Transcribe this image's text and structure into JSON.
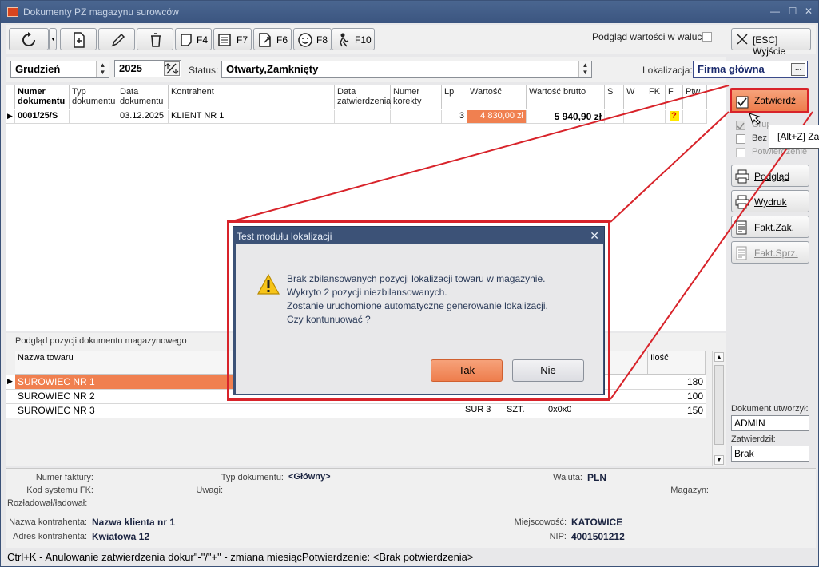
{
  "window": {
    "title": "Dokumenty PZ magazynu surowców"
  },
  "toolbar": {
    "f4": "F4",
    "f7": "F7",
    "f6": "F6",
    "f8": "F8",
    "f10": "F10",
    "currency_preview": "Podgląd wartości w walucie",
    "exit": "[ESC] Wyjście"
  },
  "filters": {
    "month": "Grudzień",
    "year": "2025",
    "status_label": "Status:",
    "status_value": "Otwarty,Zamknięty",
    "location_label": "Lokalizacja:",
    "location_value": "Firma główna",
    "browse": "..."
  },
  "grid": {
    "headers": {
      "number": "Numer dokumentu",
      "type": "Typ dokumentu",
      "date": "Data dokumentu",
      "contractor": "Kontrahent",
      "approval_date": "Data zatwierdzenia",
      "correction": "Numer korekty",
      "lp": "Lp",
      "value": "Wartość",
      "gross": "Wartość brutto",
      "s": "S",
      "w": "W",
      "fk": "FK",
      "f": "F",
      "ptw": "Ptw"
    },
    "rows": [
      {
        "number": "0001/25/S",
        "type": "",
        "date": "03.12.2025",
        "contractor": "KLIENT NR 1",
        "approval_date": "",
        "correction": "",
        "lp": "3",
        "value": "4 830,00 zł",
        "gross": "5 940,90 zł",
        "f": "?"
      }
    ]
  },
  "side": {
    "approve": "Zatwierdź",
    "group": "Grupowo",
    "bez": "Bez",
    "confirm": "Potwierdzenie",
    "preview": "Podgląd",
    "print": "Wydruk",
    "fakt_zak": "Fakt.Zak.",
    "fakt_sprz": "Fakt.Sprz.",
    "created_by_label": "Dokument utworzył:",
    "created_by": "ADMIN",
    "approved_by_label": "Zatwierdził:",
    "approved_by": "Brak",
    "tooltip": "[Alt+Z] Zatwierdź"
  },
  "items": {
    "section_title": "Podgląd pozycji dokumentu magazynowego",
    "headers": {
      "name": "Nazwa towaru",
      "qty": "Ilość"
    },
    "rows": [
      {
        "name": "SUROWIEC NR 1",
        "code": "",
        "unit": "",
        "loc": "",
        "qty": "180"
      },
      {
        "name": "SUROWIEC NR 2",
        "code": "",
        "unit": "",
        "loc": "",
        "qty": "100"
      },
      {
        "name": "SUROWIEC NR 3",
        "code": "SUR 3",
        "unit": "SZT.",
        "loc": "0x0x0",
        "qty": "150"
      }
    ]
  },
  "info": {
    "invoice_label": "Numer faktury:",
    "doctype_label": "Typ dokumentu:",
    "doctype_value": "<Główny>",
    "currency_label": "Waluta:",
    "currency_value": "PLN",
    "fk_label": "Kod systemu FK:",
    "remarks_label": "Uwagi:",
    "warehouse_label": "Magazyn:",
    "unloader_label": "Rozładował/ładował:",
    "client_name_label": "Nazwa kontrahenta:",
    "client_name": "Nazwa klienta nr 1",
    "city_label": "Miejscowość:",
    "city": "KATOWICE",
    "address_label": "Adres kontrahenta:",
    "address": "Kwiatowa 12",
    "nip_label": "NIP:",
    "nip": "4001501212"
  },
  "status": {
    "text": "Ctrl+K - Anulowanie zatwierdzenia dokur\"-\"/\"+\" - zmiana miesiącPotwierdzenie: <Brak potwierdzenia>"
  },
  "dialog": {
    "title": "Test modułu lokalizacji",
    "line1": "Brak zbilansowanych pozycji lokalizacji towaru w magazynie.",
    "line2": "Wykryto 2 pozycji niezbilansowanych.",
    "line3": "Zostanie uruchomione automatyczne generowanie lokalizacji.",
    "line4": "Czy kontunuować ?",
    "yes": "Tak",
    "no": "Nie"
  },
  "colors": {
    "accent_orange": "#f08050",
    "highlight_red": "#d8232a",
    "title_blue": "#3c5277"
  }
}
